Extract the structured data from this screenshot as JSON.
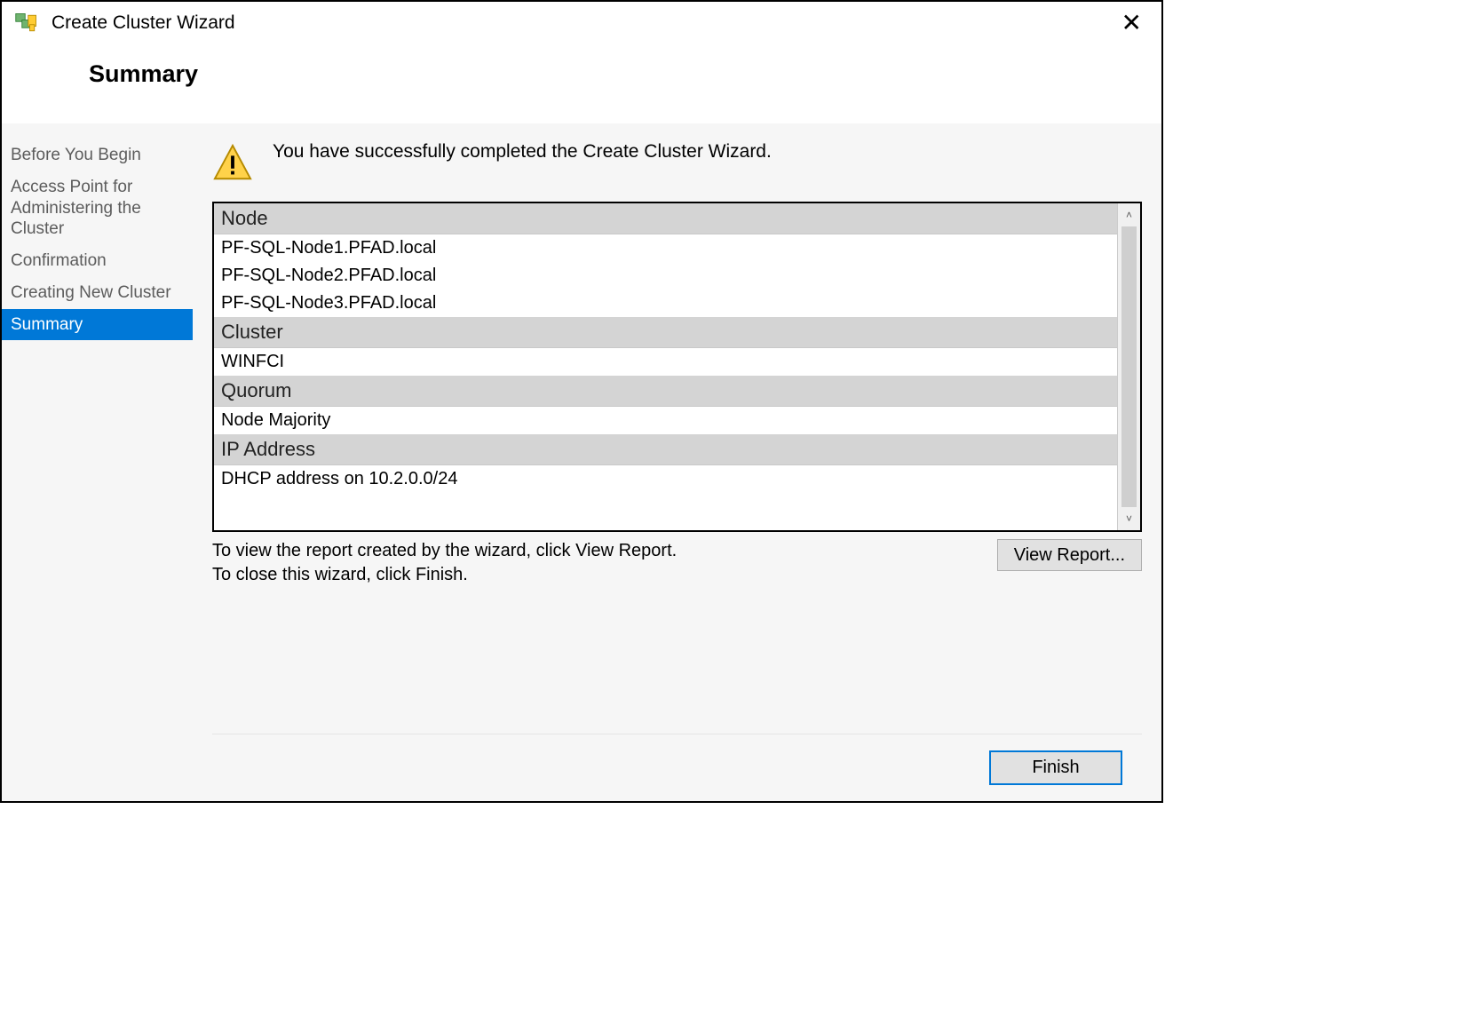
{
  "window": {
    "title": "Create Cluster Wizard"
  },
  "header": {
    "title": "Summary"
  },
  "sidebar": {
    "items": [
      {
        "label": "Before You Begin",
        "active": false
      },
      {
        "label": "Access Point for Administering the Cluster",
        "active": false
      },
      {
        "label": "Confirmation",
        "active": false
      },
      {
        "label": "Creating New Cluster",
        "active": false
      },
      {
        "label": "Summary",
        "active": true
      }
    ]
  },
  "main": {
    "status_text": "You have successfully completed the Create Cluster Wizard.",
    "report": {
      "sections": [
        {
          "header": "Node",
          "values": [
            "PF-SQL-Node1.PFAD.local",
            "PF-SQL-Node2.PFAD.local",
            "PF-SQL-Node3.PFAD.local"
          ]
        },
        {
          "header": "Cluster",
          "values": [
            "WINFCI"
          ]
        },
        {
          "header": "Quorum",
          "values": [
            "Node Majority"
          ]
        },
        {
          "header": "IP Address",
          "values": [
            "DHCP address on 10.2.0.0/24"
          ]
        }
      ]
    },
    "hint_line1": "To view the report created by the wizard, click View Report.",
    "hint_line2": "To close this wizard, click Finish.",
    "view_report_label": "View Report..."
  },
  "footer": {
    "finish_label": "Finish"
  }
}
